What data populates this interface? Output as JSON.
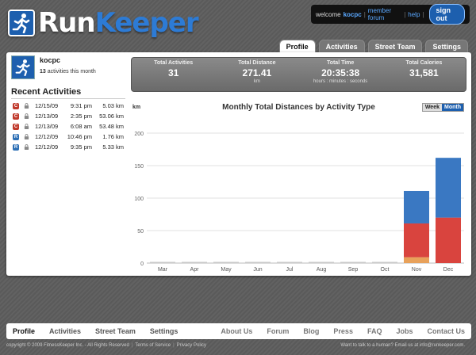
{
  "brand": {
    "run": "Run",
    "keeper": "Keeper"
  },
  "userbar": {
    "welcome": "welcome",
    "username": "kocpc",
    "forum": "member forum",
    "help": "help",
    "signout": "sign out"
  },
  "tabs": [
    {
      "label": "Profile",
      "active": true
    },
    {
      "label": "Activities",
      "active": false
    },
    {
      "label": "Street Team",
      "active": false
    },
    {
      "label": "Settings",
      "active": false
    }
  ],
  "profile": {
    "name": "kocpc",
    "count": "13",
    "count_suffix": "activities this month"
  },
  "recent": {
    "title": "Recent Activities",
    "items": [
      {
        "type": "C",
        "color": "#c0392b",
        "date": "12/15/09",
        "time": "9:31 pm",
        "distance": "5.03 km"
      },
      {
        "type": "C",
        "color": "#c0392b",
        "date": "12/13/09",
        "time": "2:35 pm",
        "distance": "53.06 km"
      },
      {
        "type": "C",
        "color": "#c0392b",
        "date": "12/13/09",
        "time": "6:08 am",
        "distance": "53.48 km"
      },
      {
        "type": "R",
        "color": "#2d6fb5",
        "date": "12/12/09",
        "time": "10:46 pm",
        "distance": "1.76 km"
      },
      {
        "type": "R",
        "color": "#2d6fb5",
        "date": "12/12/09",
        "time": "9:35 pm",
        "distance": "5.33 km"
      }
    ]
  },
  "stats": [
    {
      "label": "Total Activities",
      "value": "31",
      "unit": ""
    },
    {
      "label": "Total Distance",
      "value": "271.41",
      "unit": "km"
    },
    {
      "label": "Total Time",
      "value": "20:35:38",
      "unit": "hours : minutes : seconds"
    },
    {
      "label": "Total Calories",
      "value": "31,581",
      "unit": ""
    }
  ],
  "chart_ui": {
    "unit": "km",
    "week": "Week",
    "month": "Month"
  },
  "chart_data": {
    "type": "bar",
    "stacked": true,
    "title": "Monthly Total Distances by Activity Type",
    "ylabel": "km",
    "ylim": [
      0,
      200
    ],
    "yticks": [
      0,
      50,
      100,
      150,
      200
    ],
    "grid": true,
    "categories": [
      "Mar",
      "Apr",
      "May",
      "Jun",
      "Jul",
      "Aug",
      "Sep",
      "Oct",
      "Nov",
      "Dec"
    ],
    "series": [
      {
        "color": "#e8a15a",
        "values": [
          0,
          0,
          0,
          0,
          0,
          0,
          0,
          0,
          9,
          0
        ]
      },
      {
        "color": "#d9443e",
        "values": [
          0,
          0,
          0,
          0,
          0,
          0,
          0,
          0,
          52,
          70
        ]
      },
      {
        "color": "#3a78c2",
        "values": [
          0,
          0,
          0,
          0,
          0,
          0,
          0,
          0,
          50,
          92
        ]
      }
    ]
  },
  "footer": {
    "left": [
      "Profile",
      "Activities",
      "Street Team",
      "Settings"
    ],
    "right": [
      "About Us",
      "Forum",
      "Blog",
      "Press",
      "FAQ",
      "Jobs",
      "Contact Us"
    ],
    "copyright": "copyright © 2009 FitnessKeeper Inc. - All Rights Reserved",
    "terms": "Terms of Service",
    "privacy": "Privacy Policy",
    "contact": "Want to talk to a human? Email us at info@runkeeper.com."
  }
}
